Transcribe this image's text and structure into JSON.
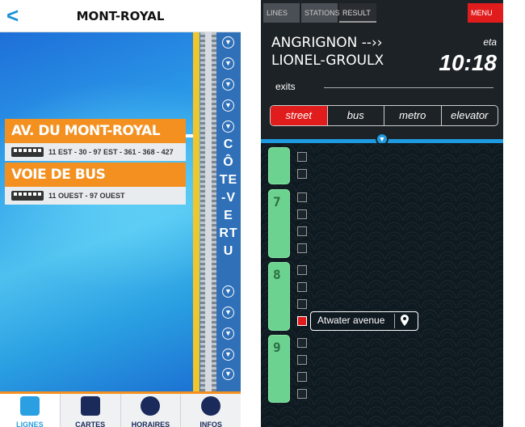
{
  "left": {
    "header": {
      "back_glyph": "<",
      "title": "MONT-ROYAL"
    },
    "vertical_line_label": "CÔTE-VERTU",
    "cards": [
      {
        "title": "AV. DU MONT-ROYAL",
        "routes": "11 EST - 30 - 97 EST - 361 - 368 - 427"
      },
      {
        "title": "VOIE DE BUS",
        "routes": "11 OUEST - 97 OUEST"
      }
    ],
    "tabs": [
      {
        "label": "LIGNES",
        "icon": "bus-icon"
      },
      {
        "label": "CARTES",
        "icon": "map-icon"
      },
      {
        "label": "HORAIRES",
        "icon": "clock-icon"
      },
      {
        "label": "INFOS",
        "icon": "info-icon"
      }
    ],
    "colors": {
      "accent": "#f39020",
      "map_blue": "#2aa0e2",
      "line_yellow": "#f2c62a"
    }
  },
  "right": {
    "top_tabs": [
      "LINES",
      "STATIONS",
      "RESULT",
      "MENU"
    ],
    "route": {
      "from": "ANGRIGNON --››",
      "to": "LIONEL-GROULX"
    },
    "eta": {
      "label": "eta",
      "time": "10:18"
    },
    "exits_label": "exits",
    "filters": [
      "street",
      "bus",
      "metro",
      "elevator"
    ],
    "active_filter": "street",
    "cars": [
      {
        "number": ""
      },
      {
        "number": "7"
      },
      {
        "number": "8"
      },
      {
        "number": "9"
      }
    ],
    "exit_callout": {
      "label": "Atwater avenue",
      "icon": "map-pin-icon"
    },
    "colors": {
      "accent_red": "#e01c1c",
      "line_blue": "#1e9be0",
      "car_green": "#6bd38f"
    }
  }
}
